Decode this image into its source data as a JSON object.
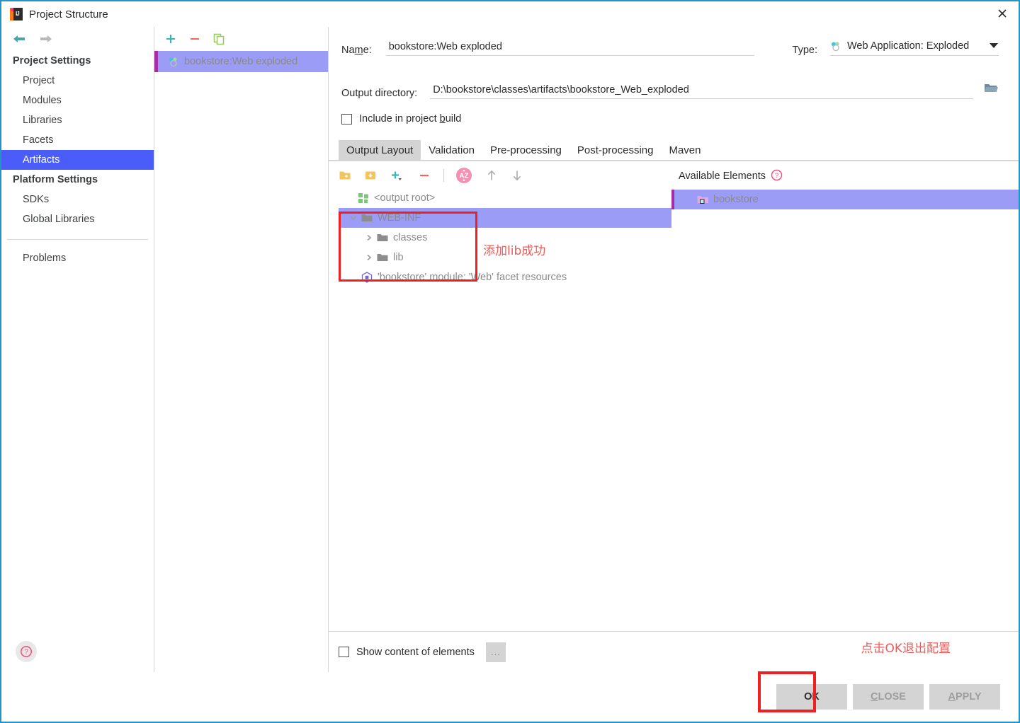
{
  "window": {
    "title": "Project Structure",
    "app_icon": "intellij-idea-icon",
    "close_icon": "close-icon"
  },
  "sidebar": {
    "back_icon": "back-arrow-icon",
    "forward_icon": "forward-arrow-icon",
    "help_icon": "help-icon",
    "groups": [
      {
        "title": "Project Settings",
        "items": [
          {
            "label": "Project",
            "selected": false
          },
          {
            "label": "Modules",
            "selected": false
          },
          {
            "label": "Libraries",
            "selected": false
          },
          {
            "label": "Facets",
            "selected": false
          },
          {
            "label": "Artifacts",
            "selected": true
          }
        ]
      },
      {
        "title": "Platform Settings",
        "items": [
          {
            "label": "SDKs",
            "selected": false
          },
          {
            "label": "Global Libraries",
            "selected": false
          }
        ]
      }
    ],
    "problems_label": "Problems"
  },
  "artifact_panel": {
    "toolbar": {
      "add_icon": "plus-icon",
      "remove_icon": "minus-icon",
      "copy_icon": "copy-icon"
    },
    "items": [
      {
        "label": "bookstore:Web exploded",
        "icon": "artifact-icon",
        "selected": true
      }
    ]
  },
  "form": {
    "name_label": "Name:",
    "name_label_pre": "Na",
    "name_label_mnemonic": "m",
    "name_label_post": "e:",
    "name_value": "bookstore:Web exploded",
    "type_label": "Type:",
    "type_value": "Web Application: Exploded",
    "type_icon": "artifact-icon",
    "type_caret_icon": "chevron-down-icon",
    "output_dir_label": "Output directory:",
    "output_dir_value": "D:\\bookstore\\classes\\artifacts\\bookstore_Web_exploded",
    "folder_browse_icon": "folder-open-icon",
    "include_build_label_pre": "Include in project ",
    "include_build_mnemonic": "b",
    "include_build_label_post": "uild",
    "include_build_checked": false
  },
  "tabs": [
    {
      "label": "Output Layout",
      "active": true
    },
    {
      "label": "Validation",
      "active": false
    },
    {
      "label": "Pre-processing",
      "active": false
    },
    {
      "label": "Post-processing",
      "active": false
    },
    {
      "label": "Maven",
      "active": false
    }
  ],
  "layout_toolbar": {
    "icons": [
      {
        "name": "add-directory-icon",
        "color": "#f2c55c"
      },
      {
        "name": "add-archive-icon",
        "color": "#f2c55c"
      },
      {
        "name": "add-copy-icon",
        "color": "#3cb4b4"
      },
      {
        "name": "remove-element-icon",
        "color": "#f2665c"
      },
      {
        "name": "sort-alphabetically-icon",
        "color": "#f090b8"
      },
      {
        "name": "move-up-icon",
        "color": "#b0b0b0"
      },
      {
        "name": "move-down-icon",
        "color": "#b0b0b0"
      }
    ]
  },
  "output_tree": {
    "root": {
      "label": "<output root>",
      "icon": "output-root-icon"
    },
    "nodes": [
      {
        "label": "WEB-INF",
        "icon": "folder-icon",
        "level": 1,
        "expanded": true,
        "selected": true
      },
      {
        "label": "classes",
        "icon": "folder-icon",
        "level": 2,
        "expanded": false,
        "selected": false
      },
      {
        "label": "lib",
        "icon": "folder-icon",
        "level": 2,
        "expanded": false,
        "selected": false
      },
      {
        "label": "'bookstore' module: 'Web' facet resources",
        "icon": "facet-resources-icon",
        "level": 1,
        "expanded": null,
        "selected": false
      }
    ]
  },
  "available_elements": {
    "title": "Available Elements",
    "help_icon": "help-icon",
    "items": [
      {
        "label": "bookstore",
        "icon": "module-folder-icon",
        "selected": true
      }
    ]
  },
  "bottom_controls": {
    "show_content_label": "Show content of elements",
    "show_content_checked": false,
    "more_button_label": "..."
  },
  "buttons": {
    "ok": "OK",
    "close_pre": "",
    "close_mnemonic": "C",
    "close_post": "LOSE",
    "close_full": "CLOSE",
    "apply_mnemonic": "A",
    "apply_post": "PPLY",
    "apply_full": "APPLY"
  },
  "annotations": {
    "tree_note": "添加lib成功",
    "ok_note": "点击OK退出配置",
    "color": "#f05a5a",
    "box_color": "#f02020"
  }
}
